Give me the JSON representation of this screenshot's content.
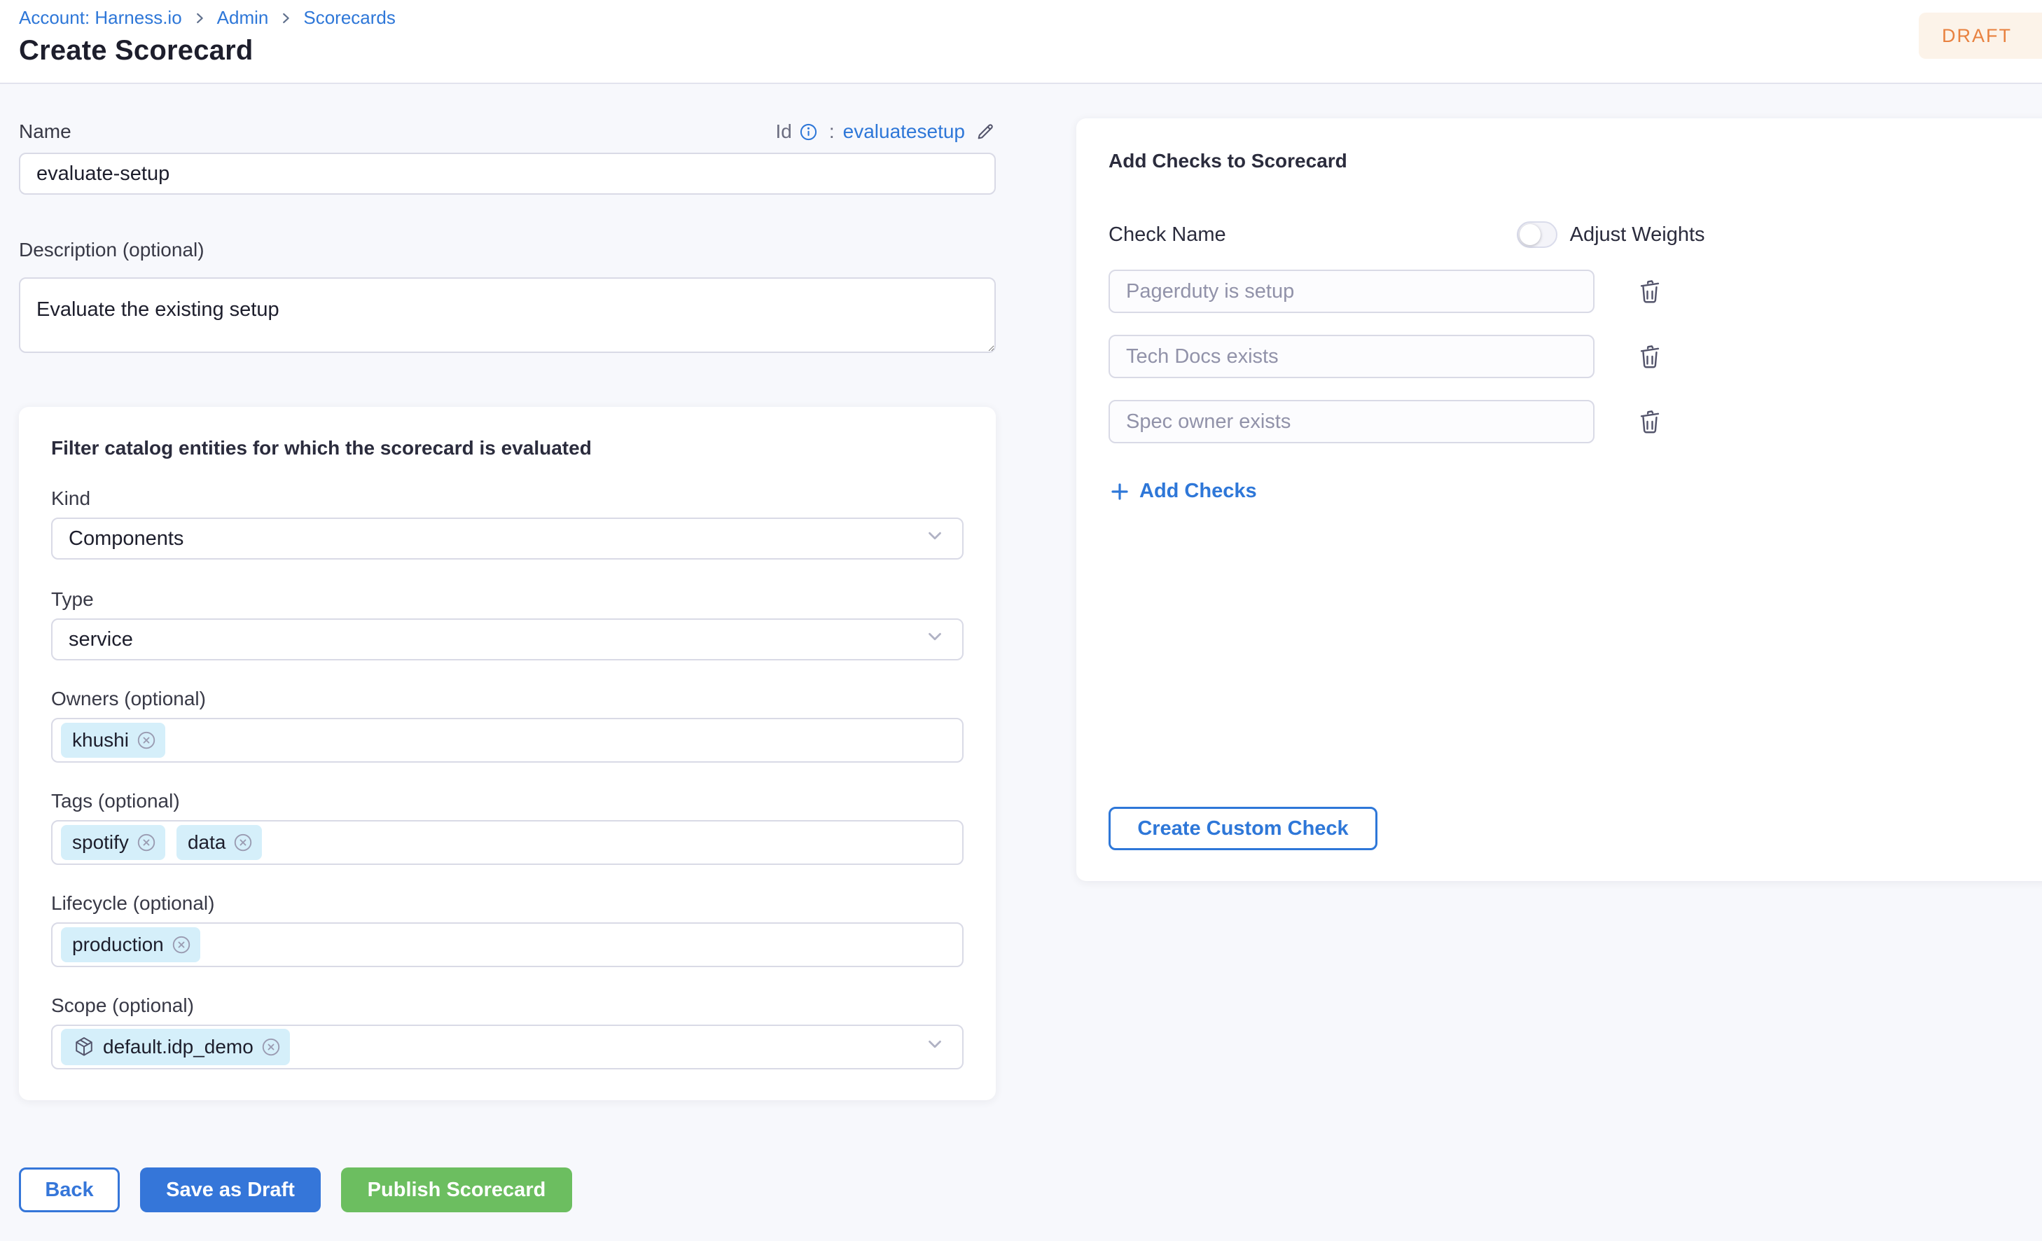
{
  "page": {
    "title": "Create Scorecard",
    "status_badge": "DRAFT"
  },
  "breadcrumb": {
    "items": [
      "Account: Harness.io",
      "Admin",
      "Scorecards"
    ]
  },
  "form": {
    "name": {
      "label": "Name",
      "value": "evaluate-setup"
    },
    "id_row": {
      "label": "Id",
      "separator": ":",
      "value": "evaluatesetup"
    },
    "description": {
      "label": "Description (optional)",
      "value": "Evaluate the existing setup"
    },
    "filter": {
      "heading": "Filter catalog entities for which the scorecard is evaluated",
      "kind": {
        "label": "Kind",
        "value": "Components"
      },
      "type": {
        "label": "Type",
        "value": "service"
      },
      "owners": {
        "label": "Owners (optional)",
        "chips": [
          "khushi"
        ]
      },
      "tags": {
        "label": "Tags (optional)",
        "chips": [
          "spotify",
          "data"
        ]
      },
      "lifecycle": {
        "label": "Lifecycle (optional)",
        "chips": [
          "production"
        ]
      },
      "scope": {
        "label": "Scope (optional)",
        "chips": [
          "default.idp_demo"
        ]
      }
    }
  },
  "checks_panel": {
    "heading": "Add Checks to Scorecard",
    "column_label": "Check Name",
    "adjust_weights_label": "Adjust Weights",
    "checks": [
      "Pagerduty is setup",
      "Tech Docs exists",
      "Spec owner exists"
    ],
    "add_checks_label": "Add Checks",
    "create_custom_check_label": "Create Custom Check"
  },
  "footer": {
    "back": "Back",
    "save_draft": "Save as Draft",
    "publish": "Publish Scorecard"
  },
  "colors": {
    "primary_blue": "#2e77d8",
    "button_blue": "#3576d9",
    "publish_green": "#6cbe60",
    "draft_text": "#e8813f",
    "draft_bg": "#fcf3e9",
    "chip_bg": "#d5effa",
    "muted_text": "#9192a9",
    "page_bg": "#f7f8fc"
  }
}
